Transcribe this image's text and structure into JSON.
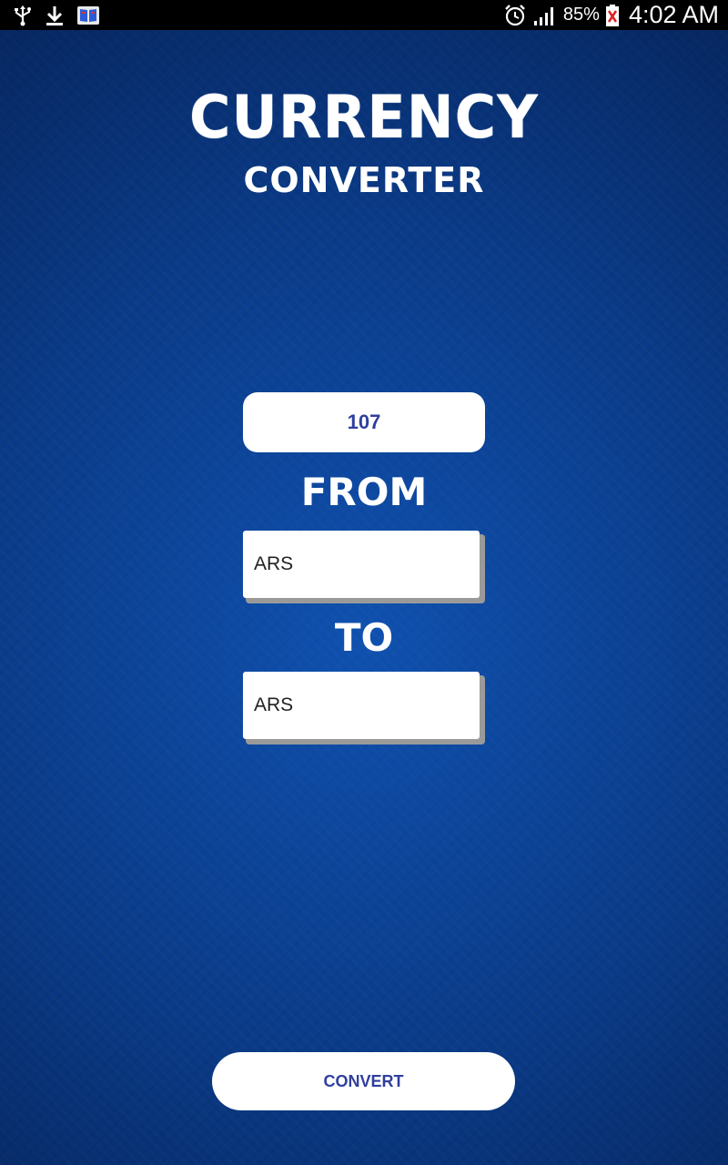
{
  "status_bar": {
    "icons_left": [
      "usb-icon",
      "download-icon",
      "dictionary-app-icon"
    ],
    "icons_right": [
      "alarm-icon",
      "signal-icon",
      "battery-icon"
    ],
    "battery": "85%",
    "time": "4:02 AM"
  },
  "app": {
    "title": "CURRENCY",
    "subtitle": "CONVERTER"
  },
  "form": {
    "amount_value": "107",
    "from_label": "FROM",
    "from_currency": "ARS",
    "to_label": "TO",
    "to_currency": "ARS",
    "convert_label": "CONVERT"
  },
  "colors": {
    "background": "#0a3a86",
    "accent_text": "#2f3f9e",
    "white": "#ffffff"
  }
}
